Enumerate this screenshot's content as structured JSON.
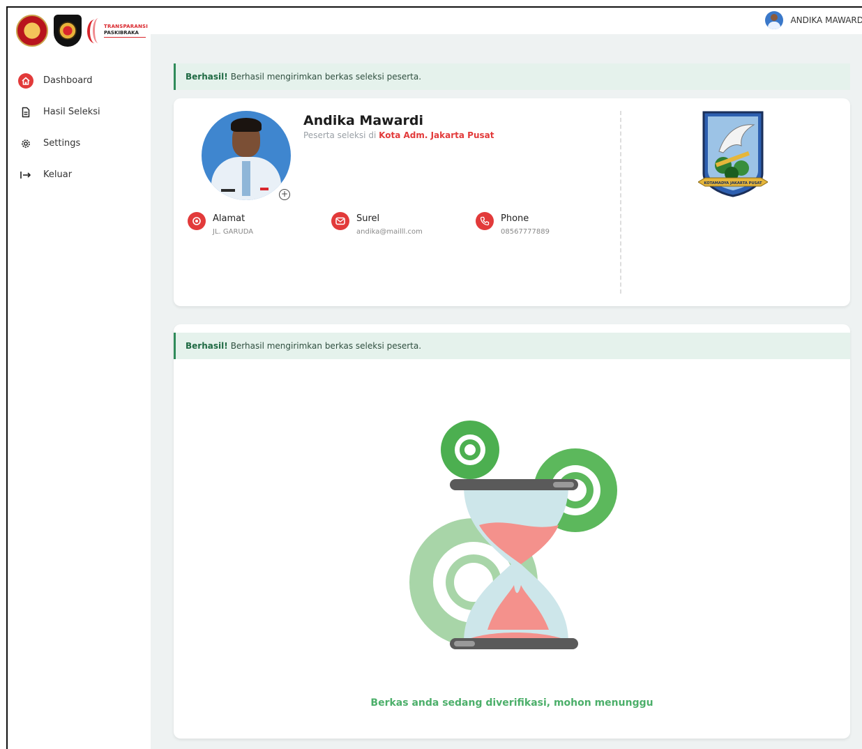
{
  "app": {
    "logo_line1": "TRANSPARANSI",
    "logo_line2": "PASKIBRAKA"
  },
  "user": {
    "name": "ANDIKA MAWARD"
  },
  "sidebar": {
    "items": [
      {
        "label": "Dashboard",
        "icon": "home-icon",
        "active": true
      },
      {
        "label": "Hasil Seleksi",
        "icon": "document-icon",
        "active": false
      },
      {
        "label": "Settings",
        "icon": "gear-icon",
        "active": false
      },
      {
        "label": "Keluar",
        "icon": "logout-icon",
        "active": false
      }
    ]
  },
  "alerts": {
    "top": {
      "strong": "Berhasil!",
      "text": "Berhasil mengirimkan berkas seleksi peserta."
    },
    "bottom": {
      "strong": "Berhasil!",
      "text": "Berhasil mengirimkan berkas seleksi peserta."
    }
  },
  "profile": {
    "name": "Andika Mawardi",
    "subtitle_prefix": "Peserta seleksi di",
    "region": "Kota Adm. Jakarta Pusat",
    "contacts": [
      {
        "title": "Alamat",
        "value": "JL. GARUDA",
        "icon": "location-icon"
      },
      {
        "title": "Surel",
        "value": "andika@mailll.com",
        "icon": "mail-icon"
      },
      {
        "title": "Phone",
        "value": "08567777889",
        "icon": "phone-icon"
      }
    ],
    "emblem_text": "KOTAMADYA JAKARTA PUSAT"
  },
  "status": {
    "message": "Berkas anda sedang diverifikasi, mohon menunggu"
  },
  "colors": {
    "accent_red": "#e23a3a",
    "success_green": "#4caf6a",
    "alert_bg": "#e5f2ec"
  }
}
